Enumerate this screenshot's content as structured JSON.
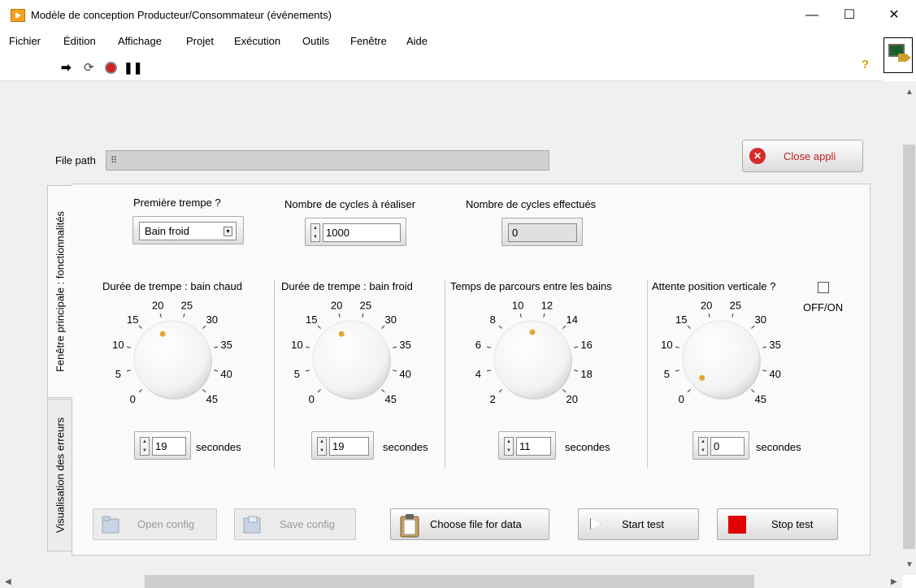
{
  "window": {
    "title": "Modèle de conception Producteur/Consommateur (événements)",
    "minimize": "—",
    "maximize": "☐",
    "close": "✕"
  },
  "menu": [
    "Fichier",
    "Édition",
    "Affichage",
    "Projet",
    "Exécution",
    "Outils",
    "Fenêtre",
    "Aide"
  ],
  "toolbar": {
    "run_icon": "run-arrow-icon",
    "run_cont_icon": "run-continuously-icon",
    "abort_icon": "abort-icon",
    "pause_icon": "pause-icon",
    "help": "?"
  },
  "file_path": {
    "label": "File path",
    "value": ""
  },
  "close_button": {
    "label": "Close appli"
  },
  "tabs": [
    {
      "label": "Fenêtre principale : fonctionnalités"
    },
    {
      "label": "Visualisation des erreurs"
    }
  ],
  "premiere_trempe": {
    "label": "Première trempe ?",
    "value": "Bain froid"
  },
  "cycles_a_realiser": {
    "label": "Nombre de cycles à réaliser",
    "value": "1000"
  },
  "cycles_effectues": {
    "label": "Nombre de cycles effectués",
    "value": "0"
  },
  "knobs": [
    {
      "label": "Durée de trempe : bain chaud",
      "ticks": [
        "0",
        "5",
        "10",
        "15",
        "20",
        "25",
        "30",
        "35",
        "40",
        "45"
      ],
      "min": 0,
      "max": 45,
      "value": "19",
      "unit": "secondes"
    },
    {
      "label": "Durée de trempe : bain froid",
      "ticks": [
        "0",
        "5",
        "10",
        "15",
        "20",
        "25",
        "30",
        "35",
        "40",
        "45"
      ],
      "min": 0,
      "max": 45,
      "value": "19",
      "unit": "secondes"
    },
    {
      "label": "Temps de parcours entre les bains",
      "ticks": [
        "2",
        "4",
        "6",
        "8",
        "10",
        "12",
        "14",
        "16",
        "18",
        "20"
      ],
      "min": 2,
      "max": 20,
      "value": "11",
      "unit": "secondes"
    },
    {
      "label": "Attente position verticale ?",
      "ticks": [
        "0",
        "5",
        "10",
        "15",
        "20",
        "25",
        "30",
        "35",
        "40",
        "45"
      ],
      "min": 0,
      "max": 45,
      "value": "0",
      "unit": "secondes"
    }
  ],
  "off_on_label": "OFF/ON",
  "buttons": {
    "open_config": "Open config",
    "save_config": "Save config",
    "choose_file": "Choose file for data",
    "start_test": "Start test",
    "stop_test": "Stop test"
  },
  "colors": {
    "stop_red": "#e00000",
    "close_red": "#d32a2a",
    "knob_dot": "#e0a830"
  }
}
